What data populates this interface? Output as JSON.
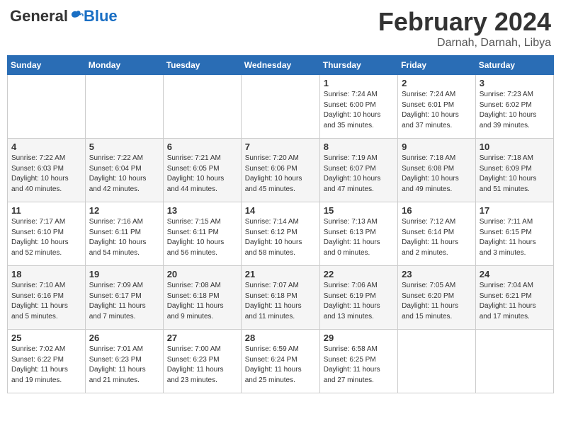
{
  "logo": {
    "general": "General",
    "blue": "Blue"
  },
  "header": {
    "title": "February 2024",
    "subtitle": "Darnah, Darnah, Libya"
  },
  "weekdays": [
    "Sunday",
    "Monday",
    "Tuesday",
    "Wednesday",
    "Thursday",
    "Friday",
    "Saturday"
  ],
  "weeks": [
    [
      {
        "day": "",
        "info": ""
      },
      {
        "day": "",
        "info": ""
      },
      {
        "day": "",
        "info": ""
      },
      {
        "day": "",
        "info": ""
      },
      {
        "day": "1",
        "info": "Sunrise: 7:24 AM\nSunset: 6:00 PM\nDaylight: 10 hours\nand 35 minutes."
      },
      {
        "day": "2",
        "info": "Sunrise: 7:24 AM\nSunset: 6:01 PM\nDaylight: 10 hours\nand 37 minutes."
      },
      {
        "day": "3",
        "info": "Sunrise: 7:23 AM\nSunset: 6:02 PM\nDaylight: 10 hours\nand 39 minutes."
      }
    ],
    [
      {
        "day": "4",
        "info": "Sunrise: 7:22 AM\nSunset: 6:03 PM\nDaylight: 10 hours\nand 40 minutes."
      },
      {
        "day": "5",
        "info": "Sunrise: 7:22 AM\nSunset: 6:04 PM\nDaylight: 10 hours\nand 42 minutes."
      },
      {
        "day": "6",
        "info": "Sunrise: 7:21 AM\nSunset: 6:05 PM\nDaylight: 10 hours\nand 44 minutes."
      },
      {
        "day": "7",
        "info": "Sunrise: 7:20 AM\nSunset: 6:06 PM\nDaylight: 10 hours\nand 45 minutes."
      },
      {
        "day": "8",
        "info": "Sunrise: 7:19 AM\nSunset: 6:07 PM\nDaylight: 10 hours\nand 47 minutes."
      },
      {
        "day": "9",
        "info": "Sunrise: 7:18 AM\nSunset: 6:08 PM\nDaylight: 10 hours\nand 49 minutes."
      },
      {
        "day": "10",
        "info": "Sunrise: 7:18 AM\nSunset: 6:09 PM\nDaylight: 10 hours\nand 51 minutes."
      }
    ],
    [
      {
        "day": "11",
        "info": "Sunrise: 7:17 AM\nSunset: 6:10 PM\nDaylight: 10 hours\nand 52 minutes."
      },
      {
        "day": "12",
        "info": "Sunrise: 7:16 AM\nSunset: 6:11 PM\nDaylight: 10 hours\nand 54 minutes."
      },
      {
        "day": "13",
        "info": "Sunrise: 7:15 AM\nSunset: 6:11 PM\nDaylight: 10 hours\nand 56 minutes."
      },
      {
        "day": "14",
        "info": "Sunrise: 7:14 AM\nSunset: 6:12 PM\nDaylight: 10 hours\nand 58 minutes."
      },
      {
        "day": "15",
        "info": "Sunrise: 7:13 AM\nSunset: 6:13 PM\nDaylight: 11 hours\nand 0 minutes."
      },
      {
        "day": "16",
        "info": "Sunrise: 7:12 AM\nSunset: 6:14 PM\nDaylight: 11 hours\nand 2 minutes."
      },
      {
        "day": "17",
        "info": "Sunrise: 7:11 AM\nSunset: 6:15 PM\nDaylight: 11 hours\nand 3 minutes."
      }
    ],
    [
      {
        "day": "18",
        "info": "Sunrise: 7:10 AM\nSunset: 6:16 PM\nDaylight: 11 hours\nand 5 minutes."
      },
      {
        "day": "19",
        "info": "Sunrise: 7:09 AM\nSunset: 6:17 PM\nDaylight: 11 hours\nand 7 minutes."
      },
      {
        "day": "20",
        "info": "Sunrise: 7:08 AM\nSunset: 6:18 PM\nDaylight: 11 hours\nand 9 minutes."
      },
      {
        "day": "21",
        "info": "Sunrise: 7:07 AM\nSunset: 6:18 PM\nDaylight: 11 hours\nand 11 minutes."
      },
      {
        "day": "22",
        "info": "Sunrise: 7:06 AM\nSunset: 6:19 PM\nDaylight: 11 hours\nand 13 minutes."
      },
      {
        "day": "23",
        "info": "Sunrise: 7:05 AM\nSunset: 6:20 PM\nDaylight: 11 hours\nand 15 minutes."
      },
      {
        "day": "24",
        "info": "Sunrise: 7:04 AM\nSunset: 6:21 PM\nDaylight: 11 hours\nand 17 minutes."
      }
    ],
    [
      {
        "day": "25",
        "info": "Sunrise: 7:02 AM\nSunset: 6:22 PM\nDaylight: 11 hours\nand 19 minutes."
      },
      {
        "day": "26",
        "info": "Sunrise: 7:01 AM\nSunset: 6:23 PM\nDaylight: 11 hours\nand 21 minutes."
      },
      {
        "day": "27",
        "info": "Sunrise: 7:00 AM\nSunset: 6:23 PM\nDaylight: 11 hours\nand 23 minutes."
      },
      {
        "day": "28",
        "info": "Sunrise: 6:59 AM\nSunset: 6:24 PM\nDaylight: 11 hours\nand 25 minutes."
      },
      {
        "day": "29",
        "info": "Sunrise: 6:58 AM\nSunset: 6:25 PM\nDaylight: 11 hours\nand 27 minutes."
      },
      {
        "day": "",
        "info": ""
      },
      {
        "day": "",
        "info": ""
      }
    ]
  ]
}
